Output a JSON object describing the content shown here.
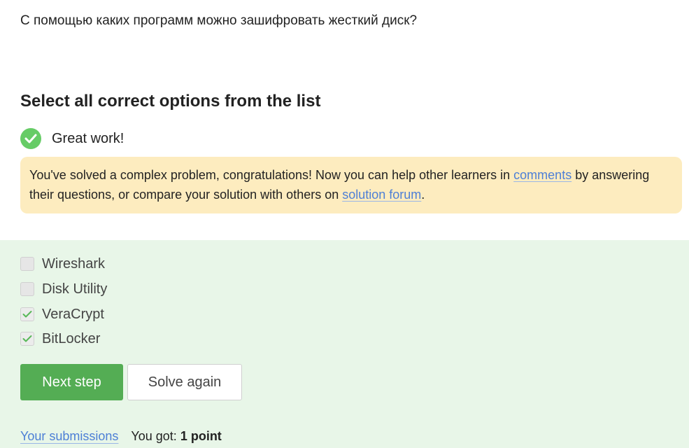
{
  "question": "С помощью каких программ можно зашифровать жесткий диск?",
  "instruction": "Select all correct options from the list",
  "status": {
    "text": "Great work!",
    "icon": "check-circle-icon",
    "color": "#66cc66"
  },
  "feedback": {
    "text_before": "You've solved a complex problem, congratulations! Now you can help other learners in ",
    "comments_link": "comments",
    "text_middle": " by answering their questions, or compare your solution with others on ",
    "forum_link": "solution forum",
    "text_after": "."
  },
  "options": [
    {
      "label": "Wireshark",
      "checked": false
    },
    {
      "label": "Disk Utility",
      "checked": false
    },
    {
      "label": "VeraCrypt",
      "checked": true
    },
    {
      "label": "BitLocker",
      "checked": true
    }
  ],
  "buttons": {
    "next": "Next step",
    "solve_again": "Solve again"
  },
  "footer": {
    "submissions_link": "Your submissions",
    "score_label": "You got:",
    "score_value": "1 point"
  },
  "colors": {
    "accent_green": "#54ad54",
    "panel_bg": "#e8f6e8",
    "feedback_bg": "#fdecbf",
    "link": "#4d7fd6"
  }
}
